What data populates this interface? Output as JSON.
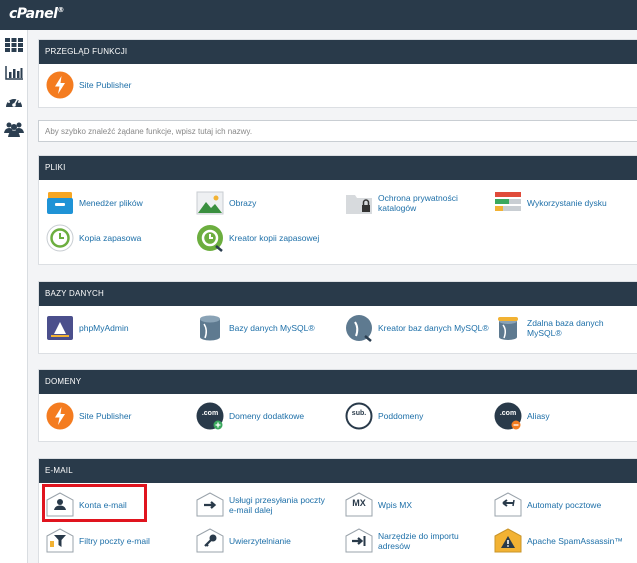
{
  "brand": {
    "logo": "cPanel",
    "logo_mark": "®"
  },
  "sidebar": {
    "icons": [
      "grid-icon",
      "stats-icon",
      "dashboard-icon",
      "users-icon"
    ]
  },
  "search": {
    "placeholder": "Aby szybko znaleźć żądane funkcje, wpisz tutaj ich nazwy."
  },
  "sections": {
    "overview": {
      "title": "PRZEGLĄD FUNKCJI",
      "items": [
        "Site Publisher"
      ]
    },
    "files": {
      "title": "PLIKI",
      "items": [
        "Menedżer plików",
        "Obrazy",
        "Ochrona prywatności katalogów",
        "Wykorzystanie dysku",
        "Kopia zapasowa",
        "Kreator kopii zapasowej"
      ]
    },
    "databases": {
      "title": "BAZY DANYCH",
      "items": [
        "phpMyAdmin",
        "Bazy danych MySQL®",
        "Kreator baz danych MySQL®",
        "Zdalna baza danych MySQL®"
      ]
    },
    "domains": {
      "title": "DOMENY",
      "items": [
        "Site Publisher",
        "Domeny dodatkowe",
        "Poddomeny",
        "Aliasy"
      ]
    },
    "email": {
      "title": "E-MAIL",
      "items": [
        "Konta e-mail",
        "Usługi przesyłania poczty e-mail dalej",
        "Wpis MX",
        "Automaty pocztowe",
        "Filtry poczty e-mail",
        "Uwierzytelnianie",
        "Narzędzie do importu adresów",
        "Apache SpamAssassin™"
      ]
    }
  },
  "icon_text": {
    "com": ".com",
    "sub": "sub.",
    "mx": "MX"
  },
  "colors": {
    "topbar": "#293a4a",
    "link": "#1d6fa8",
    "highlight": "#e0141e",
    "orange": "#f47c20"
  }
}
